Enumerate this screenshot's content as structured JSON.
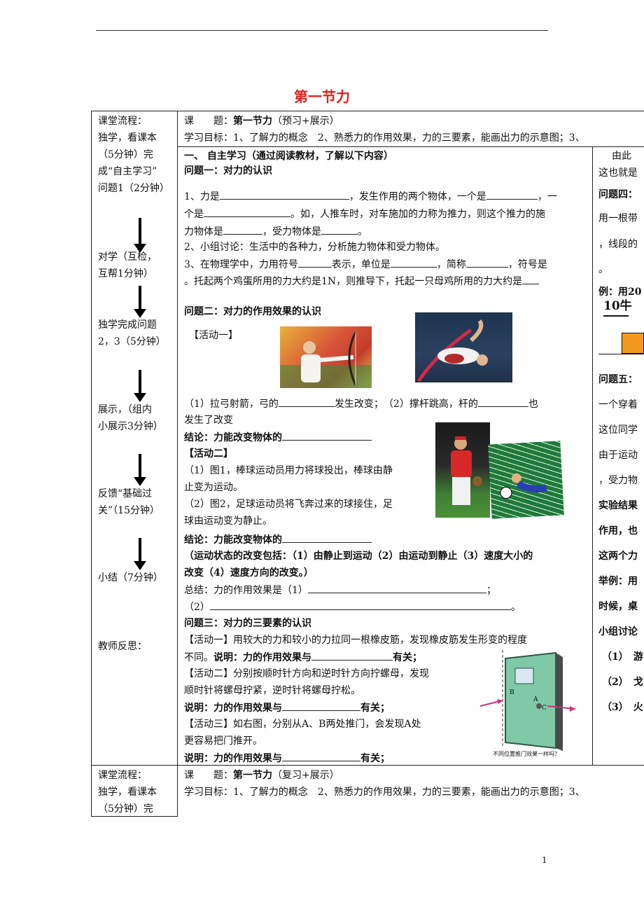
{
  "page": {
    "title": "第一节力",
    "page_number": "1"
  },
  "left": {
    "flow_label": "课堂流程：",
    "step1": [
      "独学，看课本",
      "（5分钟）完",
      "成“自主学习”",
      "问题1（2分钟）"
    ],
    "step2": [
      "对学（互检，",
      "互帮1分钟）"
    ],
    "step3": [
      "独学完成问题",
      "2，3（5分钟）"
    ],
    "step4": [
      "展示，（组内",
      "小展示3分钟）"
    ],
    "step5": [
      "反馈“基础过",
      "关”（15分钟）"
    ],
    "step6": [
      "小结（7分钟）"
    ],
    "reflection": "教师反思：",
    "next": [
      "课堂流程：",
      "独学，看课本",
      "（5分钟）完"
    ]
  },
  "header1": {
    "topic_label": "课　　题：",
    "topic_bold": "第一节力",
    "topic_suffix": "（预习+展示）",
    "goal": "学习目标：1、了解力的概念　2、熟悉力的作用效果，力的三要素，能画出力的示意图；3、"
  },
  "header2": {
    "topic_label": "课　　题：",
    "topic_bold": "第一节力",
    "topic_suffix": "（复习+展示）",
    "goal": "学习目标：1、了解力的概念　2、熟悉力的作用效果，力的三要素，能画出力的示意图；3、"
  },
  "main": {
    "sec1": "一、 自主学习（通过阅读教材，了解以下内容）",
    "q1": "问题一：对力的认识",
    "l1a": "1、力是",
    "l1b": "，发生作用的两个物体，一个是",
    "l1c": "，一",
    "l2a": "个是",
    "l2b": "。如，人推车时，对车施加的力称为推力，则这个推力的施",
    "l3a": "力物体是",
    "l3b": "，受力物体是",
    "l3c": "。",
    "l4": "2、小组讨论：生活中的各种力，分析施力物体和受力物体。",
    "l5a": "3、在物理学中，力用符号",
    "l5b": "表示，单位是",
    "l5c": "，简称",
    "l5d": "，符号是",
    "l6": "。托起两个鸡蛋所用的力大约是1N，则推导下，托起一只母鸡所用的力大约是",
    "q2": "问题二：对力的作用效果的认识",
    "act1": "【活动一】",
    "l7a": "（1）拉弓射箭，弓的",
    "l7b": "发生改变；　（2）撑杆跳高，杆的",
    "l7c": "也",
    "l8": "发生了改变",
    "c1": "结论：力能改变物体的",
    "act2": "【活动二】",
    "l9": "（1）图1，棒球运动员用力将球投出，棒球由静",
    "l10": "止变为运动。",
    "l11": "（2）图2，足球运动员将飞奔过来的球接住，足",
    "l12": "球由运动变为静止。",
    "c2": "结论：力能改变物体的",
    "l13": "（运动状态的改变包括：（1）由静止到运动（2）由运动到静止（3）速度大小的",
    "l14": "改变（4）速度方向的改变。）",
    "l15a": "总结：力的作用效果是（1）",
    "l15b": "；",
    "l16a": "（2）",
    "l16b": "。",
    "q3": "问题三：对力的三要素的认识",
    "l17": "【活动一】用较大的力和较小的力拉同一根橡皮筋，发现橡皮筋发生形变的程度",
    "l18a": "不同。",
    "l18b": "说明：力的作用效果与",
    "l18c": "有关；",
    "l19": "【活动二】分别按顺时针方向和逆时针方向拧螺母，发现",
    "l20": "顺时针将螺母拧紧，逆时针将螺母拧松。",
    "l21a": "说明：力的作用效果与",
    "l21b": "有关；",
    "l22": "【活动三】如右图，分别从A、B两处推门，会发现A处",
    "l23": "更容易把门推开。",
    "l24a": "说明：力的作用效果与",
    "l24b": "有关；",
    "door_caption": "不同位置推门效果一样吗？",
    "door_a": "A",
    "door_b": "B",
    "door_c": "C"
  },
  "right": {
    "r1": "由此",
    "r2": "这也就是",
    "r3": "问题四：",
    "r4": "用一根带",
    "r5": "，线段的",
    "r6": "。",
    "r7": "例：用20",
    "r8": "10牛",
    "r9": "问题五：",
    "r10": "一个穿着",
    "r11": "这位同学",
    "r12": "由于运动",
    "r13": "，受力物",
    "r14": "实验结果",
    "r15": "作用，也",
    "r16": "这两个力",
    "r17": "举例：用",
    "r18": "时候，桌",
    "r19": "小组讨论",
    "r20": "（1）　游",
    "r21": "（2）　戈",
    "r22": "（3）　火"
  },
  "colors": {
    "title": "#e0201c",
    "block": "#f39a1e",
    "door": "#7fc8a8",
    "arrow": "#d0307a"
  }
}
